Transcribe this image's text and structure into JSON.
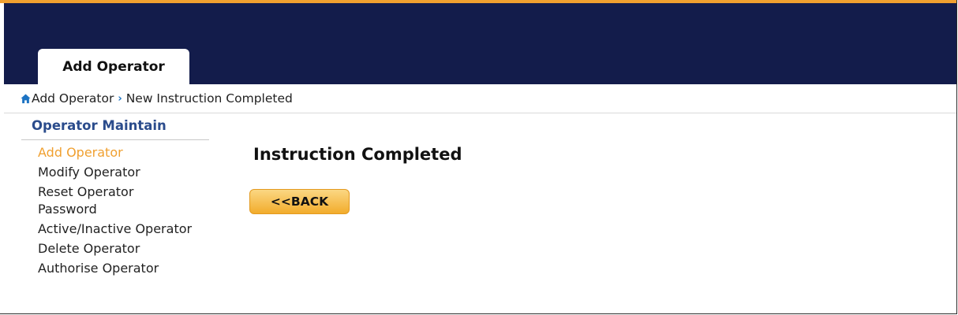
{
  "colors": {
    "header_bg": "#131c4b",
    "accent_orange": "#f0a030",
    "sidebar_title": "#2b4c8c",
    "breadcrumb_separator": "#1c73c3"
  },
  "tab": {
    "label": "Add Operator"
  },
  "breadcrumb": {
    "home_icon": "home-icon",
    "items": [
      "Add Operator",
      "New Instruction Completed"
    ]
  },
  "sidebar": {
    "title": "Operator Maintain",
    "items": [
      {
        "label": "Add Operator",
        "active": true
      },
      {
        "label": "Modify Operator"
      },
      {
        "label": "Reset Operator Password"
      },
      {
        "label": "Active/Inactive Operator"
      },
      {
        "label": "Delete Operator"
      },
      {
        "label": "Authorise Operator"
      }
    ]
  },
  "main": {
    "heading": "Instruction Completed",
    "back_label": "<<BACK"
  }
}
